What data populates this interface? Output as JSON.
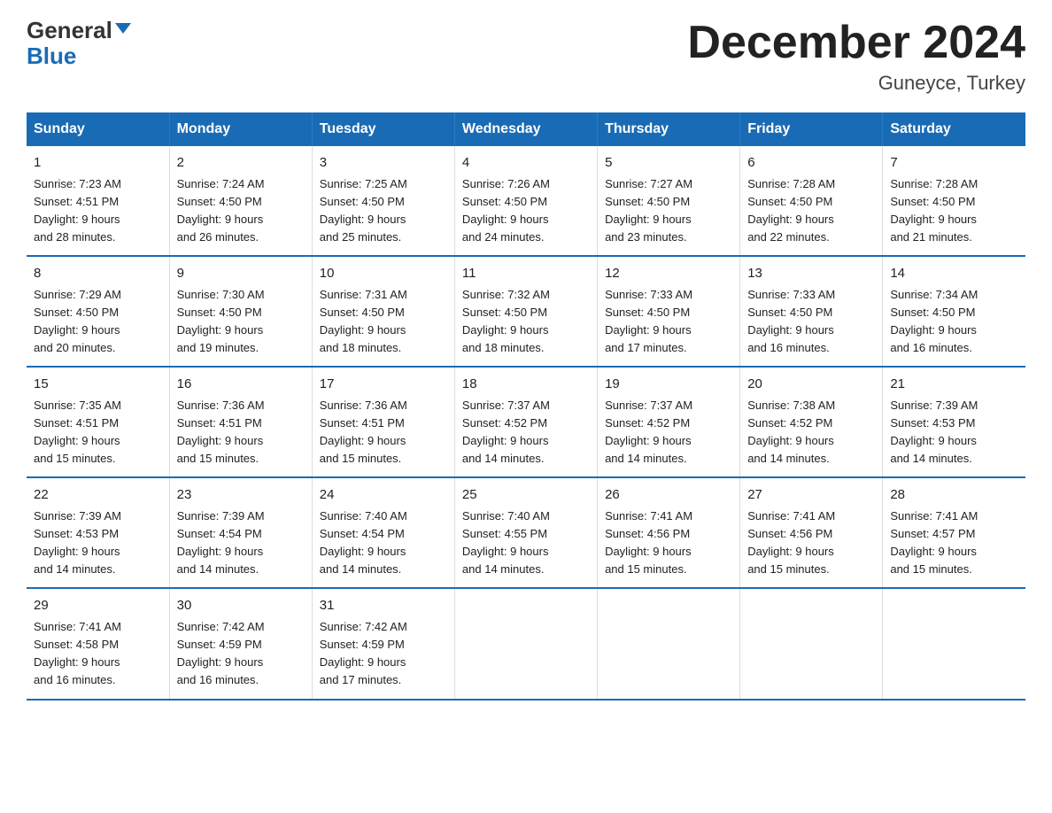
{
  "header": {
    "logo_general": "General",
    "logo_blue": "Blue",
    "month_title": "December 2024",
    "location": "Guneyce, Turkey"
  },
  "days_of_week": [
    "Sunday",
    "Monday",
    "Tuesday",
    "Wednesday",
    "Thursday",
    "Friday",
    "Saturday"
  ],
  "weeks": [
    [
      {
        "day": "1",
        "sunrise": "7:23 AM",
        "sunset": "4:51 PM",
        "daylight": "9 hours and 28 minutes."
      },
      {
        "day": "2",
        "sunrise": "7:24 AM",
        "sunset": "4:50 PM",
        "daylight": "9 hours and 26 minutes."
      },
      {
        "day": "3",
        "sunrise": "7:25 AM",
        "sunset": "4:50 PM",
        "daylight": "9 hours and 25 minutes."
      },
      {
        "day": "4",
        "sunrise": "7:26 AM",
        "sunset": "4:50 PM",
        "daylight": "9 hours and 24 minutes."
      },
      {
        "day": "5",
        "sunrise": "7:27 AM",
        "sunset": "4:50 PM",
        "daylight": "9 hours and 23 minutes."
      },
      {
        "day": "6",
        "sunrise": "7:28 AM",
        "sunset": "4:50 PM",
        "daylight": "9 hours and 22 minutes."
      },
      {
        "day": "7",
        "sunrise": "7:28 AM",
        "sunset": "4:50 PM",
        "daylight": "9 hours and 21 minutes."
      }
    ],
    [
      {
        "day": "8",
        "sunrise": "7:29 AM",
        "sunset": "4:50 PM",
        "daylight": "9 hours and 20 minutes."
      },
      {
        "day": "9",
        "sunrise": "7:30 AM",
        "sunset": "4:50 PM",
        "daylight": "9 hours and 19 minutes."
      },
      {
        "day": "10",
        "sunrise": "7:31 AM",
        "sunset": "4:50 PM",
        "daylight": "9 hours and 18 minutes."
      },
      {
        "day": "11",
        "sunrise": "7:32 AM",
        "sunset": "4:50 PM",
        "daylight": "9 hours and 18 minutes."
      },
      {
        "day": "12",
        "sunrise": "7:33 AM",
        "sunset": "4:50 PM",
        "daylight": "9 hours and 17 minutes."
      },
      {
        "day": "13",
        "sunrise": "7:33 AM",
        "sunset": "4:50 PM",
        "daylight": "9 hours and 16 minutes."
      },
      {
        "day": "14",
        "sunrise": "7:34 AM",
        "sunset": "4:50 PM",
        "daylight": "9 hours and 16 minutes."
      }
    ],
    [
      {
        "day": "15",
        "sunrise": "7:35 AM",
        "sunset": "4:51 PM",
        "daylight": "9 hours and 15 minutes."
      },
      {
        "day": "16",
        "sunrise": "7:36 AM",
        "sunset": "4:51 PM",
        "daylight": "9 hours and 15 minutes."
      },
      {
        "day": "17",
        "sunrise": "7:36 AM",
        "sunset": "4:51 PM",
        "daylight": "9 hours and 15 minutes."
      },
      {
        "day": "18",
        "sunrise": "7:37 AM",
        "sunset": "4:52 PM",
        "daylight": "9 hours and 14 minutes."
      },
      {
        "day": "19",
        "sunrise": "7:37 AM",
        "sunset": "4:52 PM",
        "daylight": "9 hours and 14 minutes."
      },
      {
        "day": "20",
        "sunrise": "7:38 AM",
        "sunset": "4:52 PM",
        "daylight": "9 hours and 14 minutes."
      },
      {
        "day": "21",
        "sunrise": "7:39 AM",
        "sunset": "4:53 PM",
        "daylight": "9 hours and 14 minutes."
      }
    ],
    [
      {
        "day": "22",
        "sunrise": "7:39 AM",
        "sunset": "4:53 PM",
        "daylight": "9 hours and 14 minutes."
      },
      {
        "day": "23",
        "sunrise": "7:39 AM",
        "sunset": "4:54 PM",
        "daylight": "9 hours and 14 minutes."
      },
      {
        "day": "24",
        "sunrise": "7:40 AM",
        "sunset": "4:54 PM",
        "daylight": "9 hours and 14 minutes."
      },
      {
        "day": "25",
        "sunrise": "7:40 AM",
        "sunset": "4:55 PM",
        "daylight": "9 hours and 14 minutes."
      },
      {
        "day": "26",
        "sunrise": "7:41 AM",
        "sunset": "4:56 PM",
        "daylight": "9 hours and 15 minutes."
      },
      {
        "day": "27",
        "sunrise": "7:41 AM",
        "sunset": "4:56 PM",
        "daylight": "9 hours and 15 minutes."
      },
      {
        "day": "28",
        "sunrise": "7:41 AM",
        "sunset": "4:57 PM",
        "daylight": "9 hours and 15 minutes."
      }
    ],
    [
      {
        "day": "29",
        "sunrise": "7:41 AM",
        "sunset": "4:58 PM",
        "daylight": "9 hours and 16 minutes."
      },
      {
        "day": "30",
        "sunrise": "7:42 AM",
        "sunset": "4:59 PM",
        "daylight": "9 hours and 16 minutes."
      },
      {
        "day": "31",
        "sunrise": "7:42 AM",
        "sunset": "4:59 PM",
        "daylight": "9 hours and 17 minutes."
      },
      null,
      null,
      null,
      null
    ]
  ],
  "labels": {
    "sunrise": "Sunrise:",
    "sunset": "Sunset:",
    "daylight": "Daylight:"
  }
}
